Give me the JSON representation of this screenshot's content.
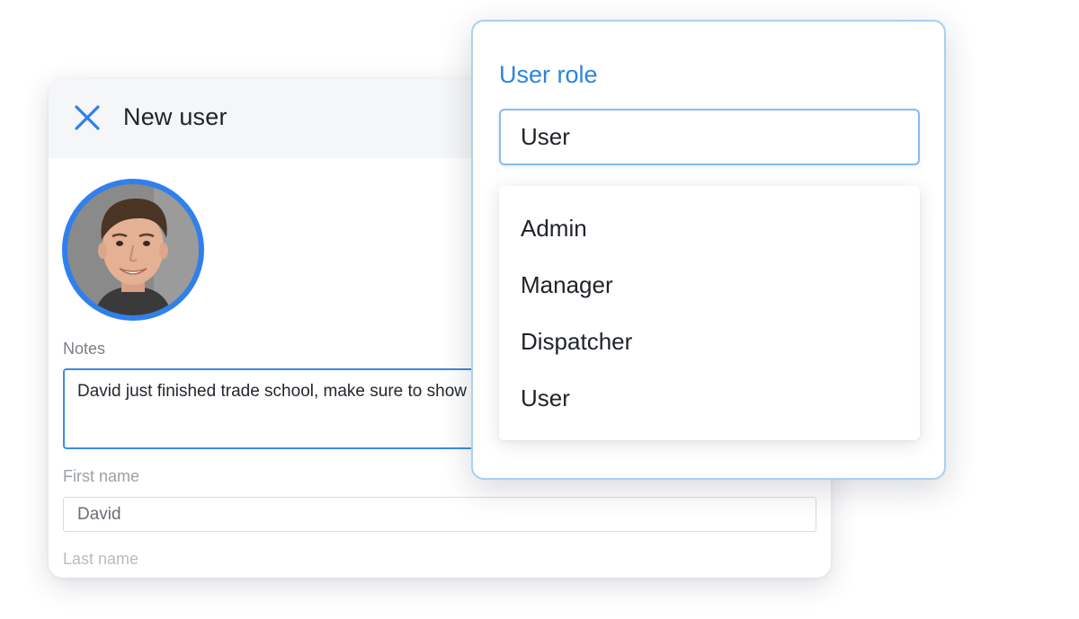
{
  "dialog": {
    "title": "New user",
    "close_icon": "close-icon",
    "avatar_icon": "user-photo"
  },
  "notes": {
    "label": "Notes",
    "value": "David just finished trade school, make sure to show him the ropes"
  },
  "first_name": {
    "label": "First name",
    "value": "David"
  },
  "last_name": {
    "label": "Last name"
  },
  "role_picker": {
    "title": "User role",
    "selected": "User",
    "options": [
      "Admin",
      "Manager",
      "Dispatcher",
      "User"
    ]
  },
  "colors": {
    "accent": "#2f80ed",
    "title_blue": "#2b84de",
    "header_bg": "#f5f6f8"
  }
}
